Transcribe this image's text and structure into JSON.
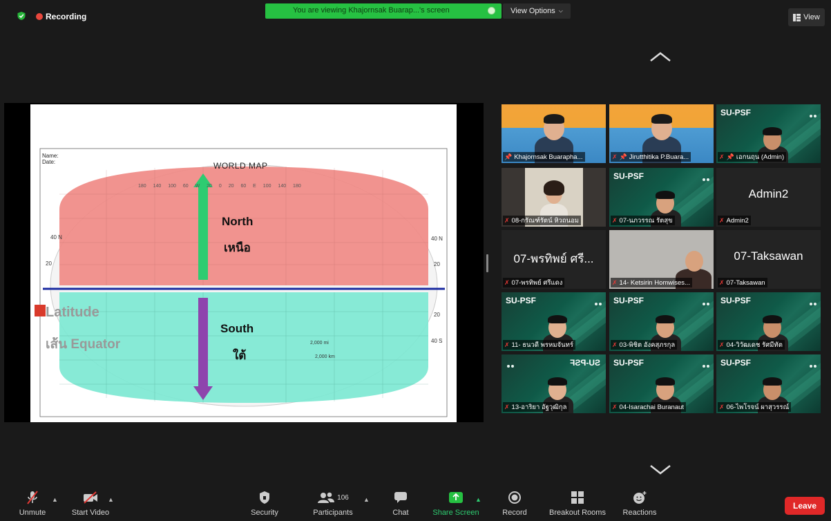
{
  "topbar": {
    "recording_label": "Recording",
    "viewing_banner": "You are viewing Khajornsak Buarap...'s screen",
    "view_options_label": "View Options",
    "view_button_label": "View"
  },
  "slide": {
    "name_label": "Name:",
    "date_label": "Date:",
    "map_title": "WORLD MAP",
    "north_en": "North",
    "north_th": "เหนือ",
    "south_en": "South",
    "south_th": "ใต้",
    "latitude_word": "Latitude",
    "equator_word": "เส้น Equator",
    "lat_labels_left": [
      "40 N",
      "20",
      "20",
      "40"
    ],
    "lat_labels_right": [
      "40 N",
      "20",
      "20",
      "40 S"
    ],
    "scale_mi": "2,000 mi",
    "scale_km": "2,000 km",
    "long_top": "180 140 100 60 W 20 0 20 60 E 100 140 180",
    "colors": {
      "north": "#f08a86",
      "south": "#7de8d2",
      "equator": "#1a2aa0",
      "arrow_up": "#2ecc71",
      "arrow_down": "#8e44ad"
    }
  },
  "participants": [
    {
      "label": "Khajornsak Buarapha...",
      "muted": false,
      "pinned": true,
      "kind": "video19",
      "highlight": true
    },
    {
      "label": "Jirutthitika P.Buara...",
      "muted": true,
      "pinned": true,
      "kind": "video19",
      "highlight": false
    },
    {
      "label": "เอกนฤน (Admin)",
      "muted": true,
      "pinned": true,
      "kind": "psf",
      "psf": "SU-PSF"
    },
    {
      "label": "08-กรัณฑ์รัตน์ หิวถนอม",
      "muted": true,
      "kind": "room"
    },
    {
      "label": "07-นภวรรณ รัตสุข",
      "muted": true,
      "kind": "psf",
      "psf": "SU-PSF"
    },
    {
      "label": "Admin2",
      "muted": true,
      "kind": "name",
      "big": "Admin2"
    },
    {
      "label": "07-พรทิพย์ ศรีแดง",
      "muted": true,
      "kind": "name",
      "big": "07-พรทิพย์ ศรี..."
    },
    {
      "label": "14- Ketsirin Homwises...",
      "muted": true,
      "kind": "room2"
    },
    {
      "label": "07-Taksawan",
      "muted": true,
      "kind": "name",
      "big": "07-Taksawan"
    },
    {
      "label": "11- ธนวดี พรหมจันทร์",
      "muted": true,
      "kind": "psf",
      "psf": "SU-PSF"
    },
    {
      "label": "03-พิชิต อังคสุภรกุล",
      "muted": true,
      "kind": "psf",
      "psf": "SU-PSF"
    },
    {
      "label": "04-วิวัฒเดช รัศมีทัต",
      "muted": true,
      "kind": "psf",
      "psf": "SU-PSF"
    },
    {
      "label": "13-อาริยา อัฐวุฒิกุล",
      "muted": true,
      "kind": "psf-mirror",
      "psf": "SU-PSF"
    },
    {
      "label": "04-Isarachai Buranaut",
      "muted": true,
      "kind": "psf",
      "psf": "SU-PSF"
    },
    {
      "label": "06-ไพโรจน์ ผาสุวรรณ์",
      "muted": true,
      "kind": "psf",
      "psf": "SU-PSF"
    }
  ],
  "toolbar": {
    "unmute": "Unmute",
    "start_video": "Start Video",
    "security": "Security",
    "participants": "Participants",
    "participants_count": "106",
    "chat": "Chat",
    "share_screen": "Share Screen",
    "record": "Record",
    "breakout_rooms": "Breakout Rooms",
    "reactions": "Reactions",
    "leave": "Leave"
  }
}
